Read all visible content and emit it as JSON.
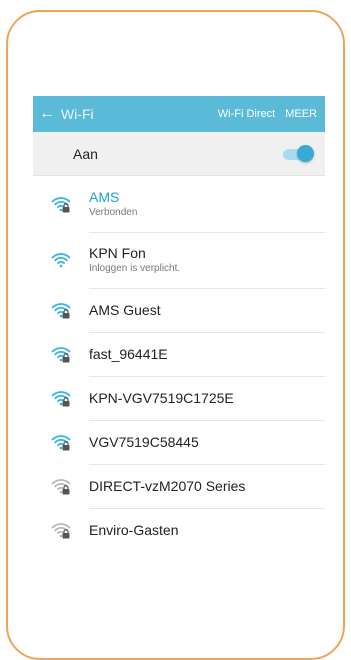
{
  "app_bar": {
    "back_icon": "arrow-left-icon",
    "title": "Wi-Fi",
    "wifi_direct_label": "Wi-Fi Direct",
    "more_label": "MEER",
    "color": "#5bbad8"
  },
  "master_toggle": {
    "label": "Aan",
    "state": "on",
    "accent": "#3aa9d3"
  },
  "networks": [
    {
      "name": "AMS",
      "status": "Verbonden",
      "secured": true,
      "connected": true,
      "signal_color": "#34b5e5"
    },
    {
      "name": "KPN Fon",
      "status": "Inloggen is verplicht.",
      "secured": false,
      "connected": false,
      "signal_color": "#34b5e5"
    },
    {
      "name": "AMS Guest",
      "status": "",
      "secured": true,
      "connected": false,
      "signal_color": "#34b5e5"
    },
    {
      "name": "fast_96441E",
      "status": "",
      "secured": true,
      "connected": false,
      "signal_color": "#34b5e5"
    },
    {
      "name": "KPN-VGV7519C1725E",
      "status": "",
      "secured": true,
      "connected": false,
      "signal_color": "#34b5e5"
    },
    {
      "name": "VGV7519C58445",
      "status": "",
      "secured": true,
      "connected": false,
      "signal_color": "#34b5e5"
    },
    {
      "name": "DIRECT-vzM2070 Series",
      "status": "",
      "secured": true,
      "connected": false,
      "signal_color": "#b8b8b8"
    },
    {
      "name": "Enviro-Gasten",
      "status": "",
      "secured": true,
      "connected": false,
      "signal_color": "#b8b8b8"
    }
  ]
}
